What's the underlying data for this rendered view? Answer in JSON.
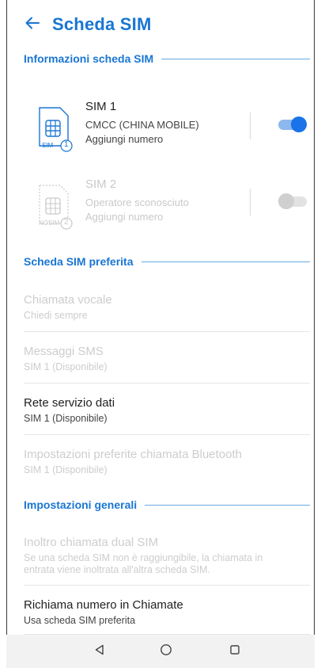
{
  "header": {
    "title": "Scheda SIM"
  },
  "sections": {
    "sim_info": "Informazioni scheda SIM",
    "preferred": "Scheda SIM preferita",
    "general": "Impostazioni generali"
  },
  "sims": [
    {
      "name": "SIM 1",
      "carrier": "CMCC (CHINA MOBILE)",
      "action": "Aggiungi numero",
      "icon_label": "SIM",
      "icon_number": "1",
      "enabled": true
    },
    {
      "name": "SIM 2",
      "carrier": "Operatore sconosciuto",
      "action": "Aggiungi numero",
      "icon_label": "NOSIM",
      "icon_number": "2",
      "enabled": false
    }
  ],
  "preferred_items": [
    {
      "title": "Chiamata vocale",
      "subtitle": "Chiedi sempre",
      "enabled": false
    },
    {
      "title": "Messaggi SMS",
      "subtitle": "SIM 1 (Disponibile)",
      "enabled": false
    },
    {
      "title": "Rete servizio dati",
      "subtitle": "SIM 1 (Disponibile)",
      "enabled": true
    },
    {
      "title": "Impostazioni preferite chiamata Bluetooth",
      "subtitle": "SIM 1 (Disponibile)",
      "enabled": false
    }
  ],
  "general_items": [
    {
      "title": "Inoltro chiamata dual SIM",
      "subtitle_line1": "Se una scheda SIM non è raggiungibile, la chiamata in",
      "subtitle_line2": "entrata viene inoltrata all'altra scheda SIM.",
      "enabled": false
    },
    {
      "title": "Richiama numero in Chiamate",
      "subtitle": "Usa scheda SIM preferita",
      "enabled": true
    }
  ],
  "colors": {
    "accent": "#1976d2",
    "disabled_text": "#cdcdcd",
    "toggle_track_on": "#8cb8ee",
    "toggle_knob_on": "#1a73e8"
  },
  "icons": {
    "back": "arrow-back-icon",
    "nav_back": "triangle-back-icon",
    "nav_home": "circle-home-icon",
    "nav_recents": "square-recents-icon"
  }
}
